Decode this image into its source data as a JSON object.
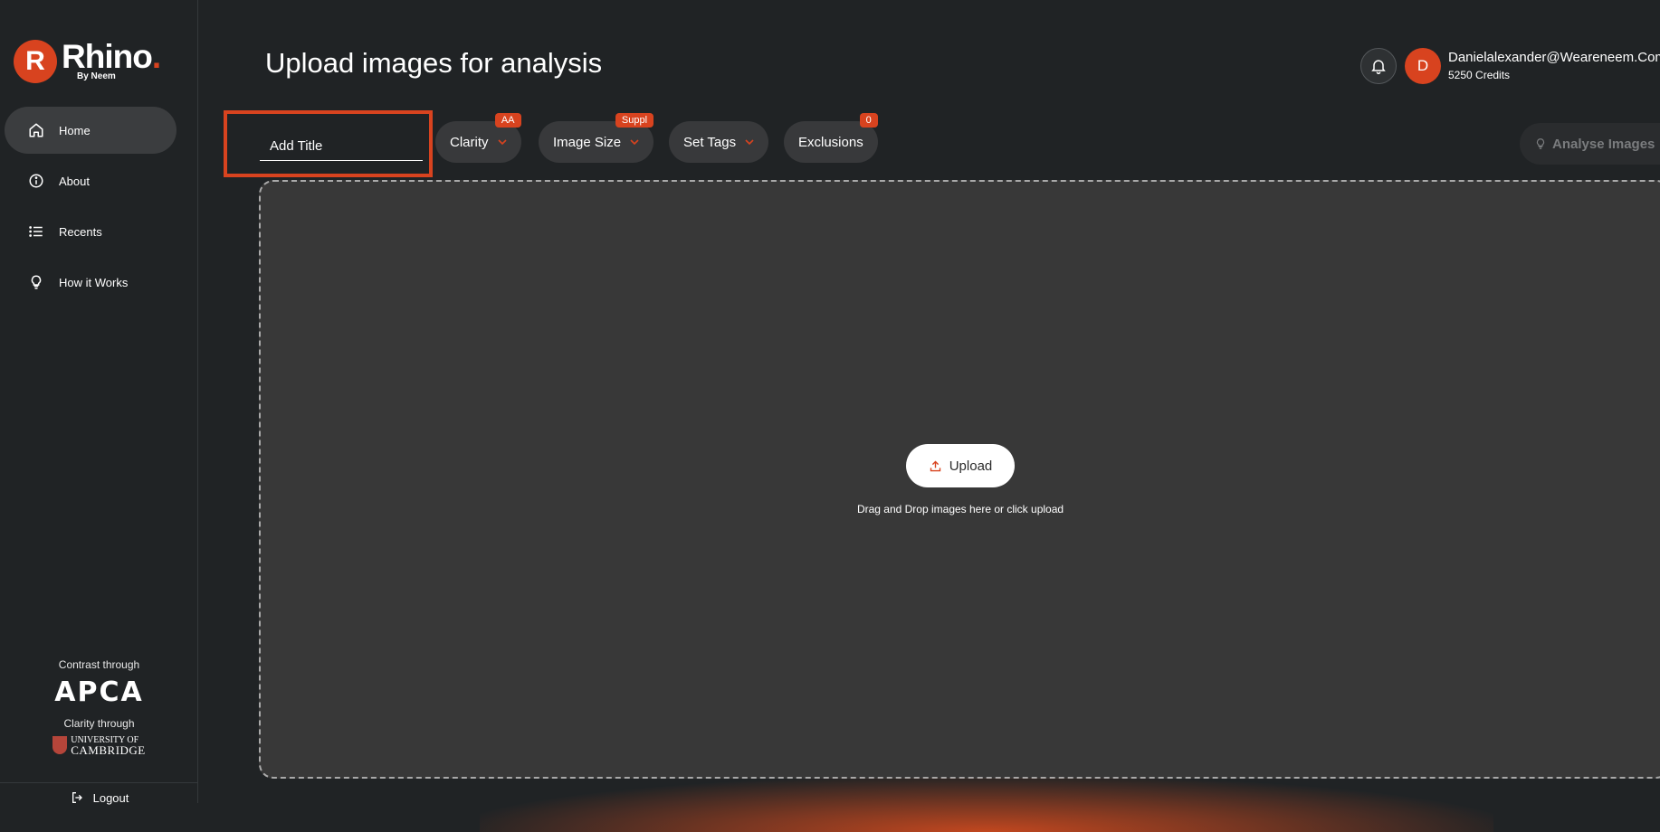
{
  "brand": {
    "logo_word": "Rhino",
    "logo_sub": "By Neem"
  },
  "sidebar": {
    "items": [
      {
        "label": "Home",
        "icon": "home-icon",
        "active": true
      },
      {
        "label": "About",
        "icon": "info-icon",
        "active": false
      },
      {
        "label": "Recents",
        "icon": "list-icon",
        "active": false
      },
      {
        "label": "How it Works",
        "icon": "lightbulb-icon",
        "active": false
      }
    ],
    "contrast_label": "Contrast through",
    "apca": "APCA",
    "clarity_label": "Clarity through",
    "cambridge_line1": "UNIVERSITY OF",
    "cambridge_line2": "CAMBRIDGE",
    "logout": "Logout"
  },
  "header": {
    "title": "Upload images for analysis",
    "user_initial": "D",
    "user_email": "Danielalexander@Weareneem.Com",
    "user_credits": "5250 Credits"
  },
  "toolbar": {
    "title_placeholder": "Add Title",
    "clarity": {
      "label": "Clarity",
      "badge": "AA"
    },
    "image_size": {
      "label": "Image Size",
      "badge": "Suppl"
    },
    "set_tags": {
      "label": "Set Tags"
    },
    "exclusions": {
      "label": "Exclusions",
      "badge": "0"
    },
    "analyse": "Analyse Images"
  },
  "dropzone": {
    "upload_label": "Upload",
    "hint": "Drag and Drop images here or click upload"
  },
  "colors": {
    "accent": "#d8431f",
    "background": "#202325",
    "dropzone": "#383838"
  }
}
